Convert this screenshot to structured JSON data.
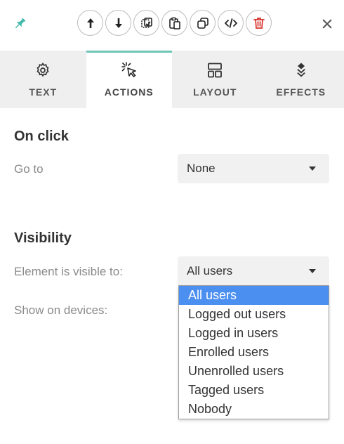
{
  "toolbar": {
    "pin_icon": "pin-icon",
    "accent": "#3fb9a8",
    "tools": [
      {
        "name": "move-up-button",
        "icon": "arrow-up-icon"
      },
      {
        "name": "move-down-button",
        "icon": "arrow-down-icon"
      },
      {
        "name": "copy-style-button",
        "icon": "copy-style-icon"
      },
      {
        "name": "paste-button",
        "icon": "clipboard-icon"
      },
      {
        "name": "duplicate-button",
        "icon": "duplicate-icon"
      },
      {
        "name": "code-button",
        "icon": "code-icon"
      },
      {
        "name": "delete-button",
        "icon": "trash-icon",
        "color": "#d6342c"
      }
    ],
    "close_icon": "close-icon"
  },
  "tabs": [
    {
      "label": "TEXT",
      "icon": "gear-icon",
      "active": false
    },
    {
      "label": "ACTIONS",
      "icon": "click-cursor-icon",
      "active": true
    },
    {
      "label": "LAYOUT",
      "icon": "layout-icon",
      "active": false
    },
    {
      "label": "EFFECTS",
      "icon": "layers-icon",
      "active": false
    }
  ],
  "on_click": {
    "title": "On click",
    "go_to_label": "Go to",
    "go_to_value": "None"
  },
  "visibility": {
    "title": "Visibility",
    "visible_to_label": "Element is visible to:",
    "visible_to_value": "All users",
    "devices_label": "Show on devices:",
    "options": [
      "All users",
      "Logged out users",
      "Logged in users",
      "Enrolled users",
      "Unenrolled users",
      "Tagged users",
      "Nobody"
    ],
    "selected_option": "All users",
    "selection_color": "#4b8ff0"
  }
}
